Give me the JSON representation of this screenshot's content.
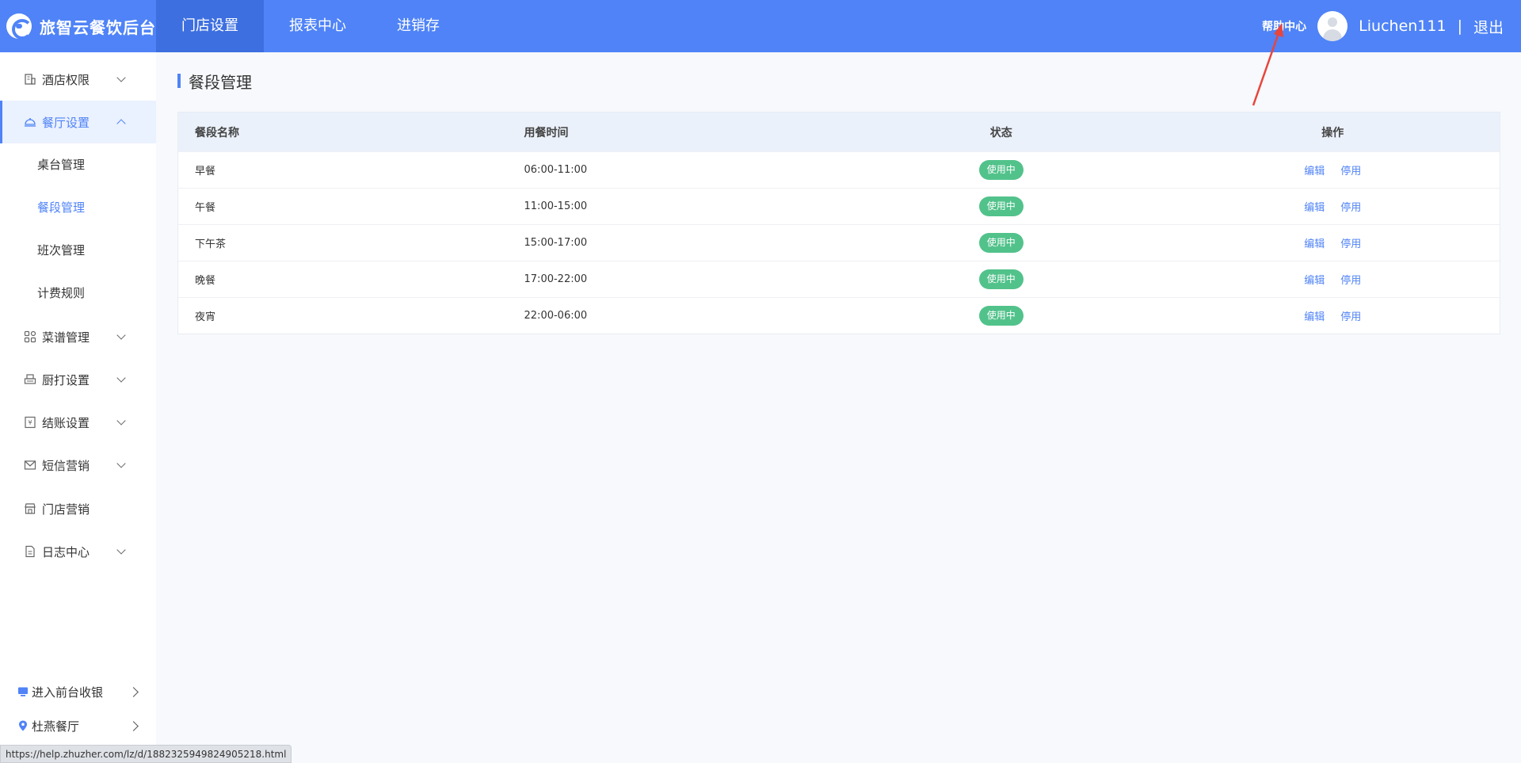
{
  "brand": {
    "name": "旅智云餐饮后台"
  },
  "topnav": {
    "items": [
      "门店设置",
      "报表中心",
      "进销存"
    ]
  },
  "header": {
    "help": "帮助中心",
    "username": "Liuchen111",
    "divider": "|",
    "logout": "退出"
  },
  "sidebar": {
    "items": [
      {
        "label": "酒店权限"
      },
      {
        "label": "餐厅设置"
      },
      {
        "label": "菜谱管理"
      },
      {
        "label": "厨打设置"
      },
      {
        "label": "结账设置"
      },
      {
        "label": "短信营销"
      },
      {
        "label": "门店营销"
      },
      {
        "label": "日志中心"
      }
    ],
    "subitems": [
      "桌台管理",
      "餐段管理",
      "班次管理",
      "计费规则"
    ],
    "bottom": [
      {
        "label": "进入前台收银"
      },
      {
        "label": "杜燕餐厅"
      }
    ]
  },
  "page": {
    "title": "餐段管理"
  },
  "table": {
    "headers": [
      "餐段名称",
      "用餐时间",
      "状态",
      "操作"
    ],
    "rows": [
      {
        "name": "早餐",
        "time": "06:00-11:00",
        "status": "使用中",
        "edit": "编辑",
        "disable": "停用"
      },
      {
        "name": "午餐",
        "time": "11:00-15:00",
        "status": "使用中",
        "edit": "编辑",
        "disable": "停用"
      },
      {
        "name": "下午茶",
        "time": "15:00-17:00",
        "status": "使用中",
        "edit": "编辑",
        "disable": "停用"
      },
      {
        "name": "晚餐",
        "time": "17:00-22:00",
        "status": "使用中",
        "edit": "编辑",
        "disable": "停用"
      },
      {
        "name": "夜宵",
        "time": "22:00-06:00",
        "status": "使用中",
        "edit": "编辑",
        "disable": "停用"
      }
    ]
  },
  "status_url": "https://help.zhuzher.com/lz/d/1882325949824905218.html",
  "colors": {
    "primary": "#4f83f7",
    "success": "#52c28b",
    "annotation": "#e8453c"
  }
}
